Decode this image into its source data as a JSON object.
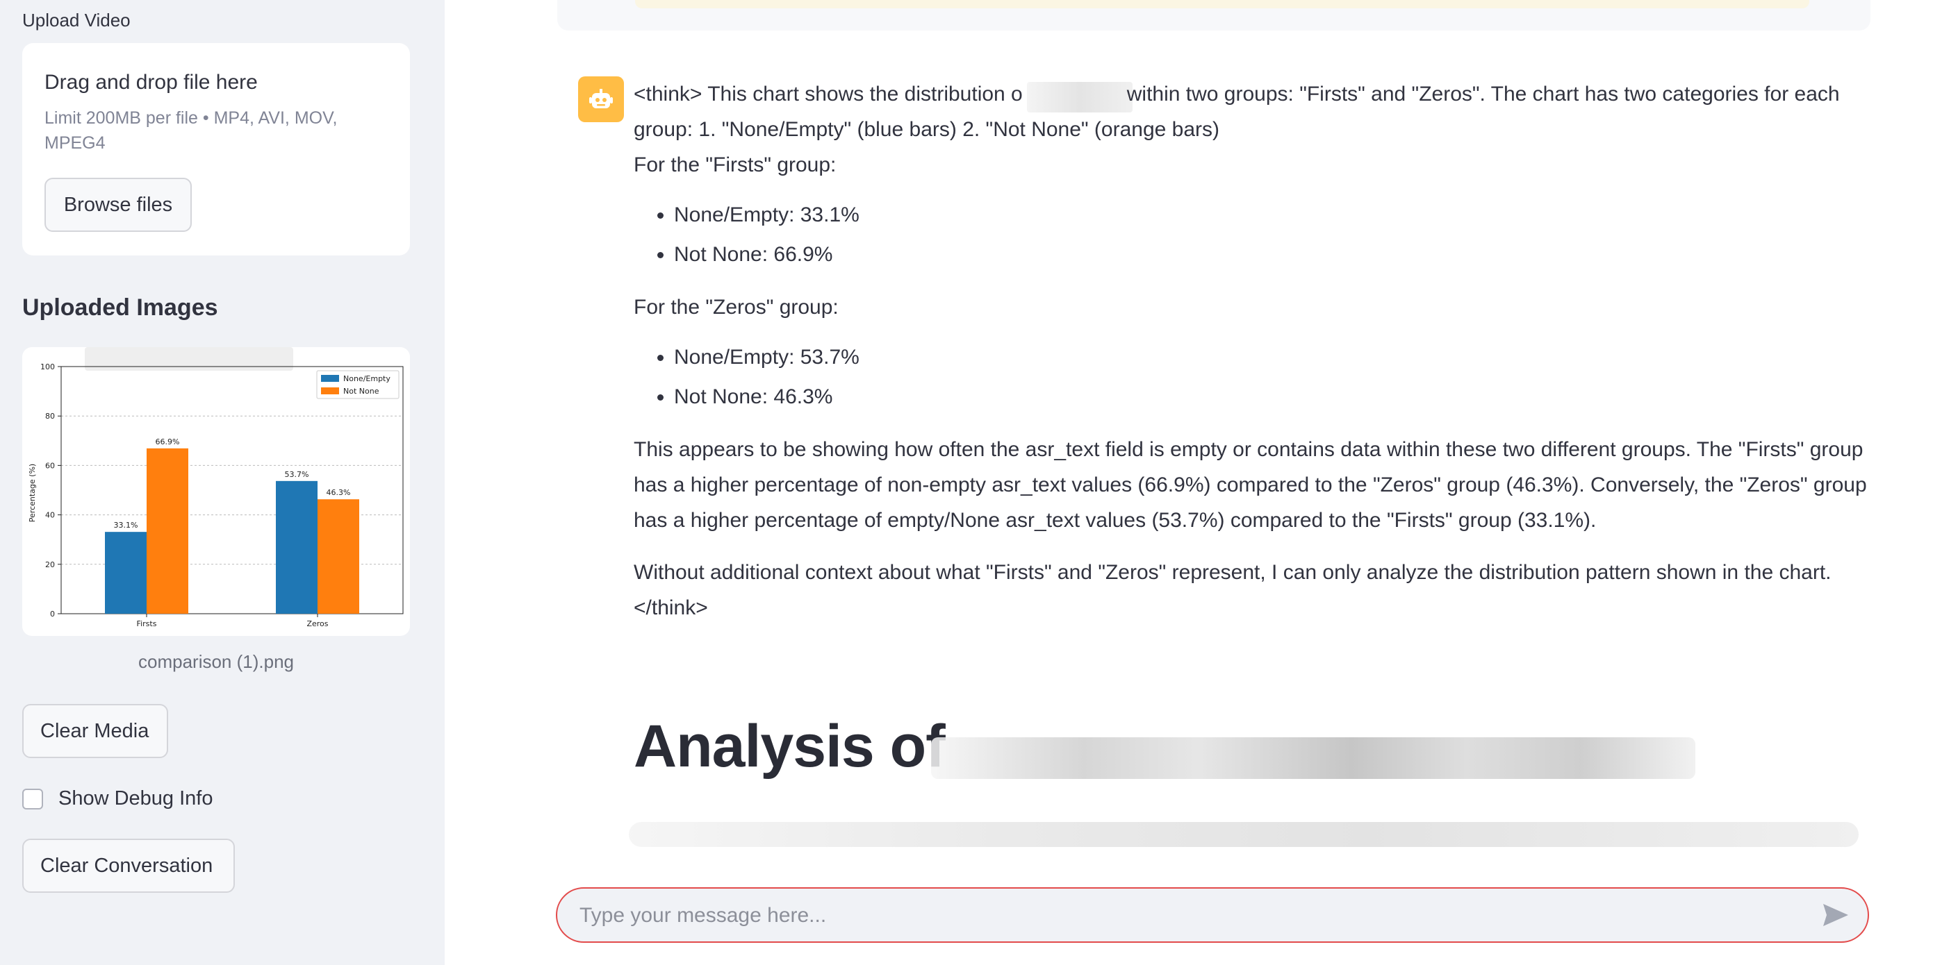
{
  "sidebar": {
    "upload_label": "Upload Video",
    "dropzone_title": "Drag and drop file here",
    "dropzone_limit": "Limit 200MB per file • MP4, AVI, MOV, MPEG4",
    "browse_label": "Browse files",
    "uploaded_heading": "Uploaded Images",
    "image_caption": "comparison (1).png",
    "clear_media_label": "Clear Media",
    "debug_label": "Show Debug Info",
    "debug_checked": false,
    "clear_conversation_label": "Clear Conversation"
  },
  "chart_data": {
    "type": "bar",
    "categories": [
      "Firsts",
      "Zeros"
    ],
    "series": [
      {
        "name": "None/Empty",
        "values": [
          33.1,
          53.7
        ],
        "color": "#1f77b4"
      },
      {
        "name": "Not None",
        "values": [
          66.9,
          46.3
        ],
        "color": "#ff7f0e"
      }
    ],
    "data_labels": [
      [
        "33.1%",
        "53.7%"
      ],
      [
        "66.9%",
        "46.3%"
      ]
    ],
    "ylabel": "Percentage (%)",
    "ylim": [
      0,
      100
    ],
    "yticks": [
      "0",
      "20",
      "40",
      "60",
      "80",
      "100"
    ],
    "grid": true,
    "legend_position": "top-right"
  },
  "chat": {
    "avatar_icon": "robot-icon",
    "intro_a": "<think> This chart shows the distribution o",
    "intro_b": "within two groups: \"Firsts\" and \"Zeros\". The chart has two categories for each group: 1. \"None/Empty\" (blue bars) 2. \"Not None\" (orange bars)",
    "firsts_heading": "For the \"Firsts\" group:",
    "firsts_items": [
      "None/Empty: 33.1%",
      "Not None: 66.9%"
    ],
    "zeros_heading": "For the \"Zeros\" group:",
    "zeros_items": [
      "None/Empty: 53.7%",
      "Not None: 46.3%"
    ],
    "paragraph_1": "This appears to be showing how often the asr_text field is empty or contains data within these two different groups. The \"Firsts\" group has a higher percentage of non-empty asr_text values (66.9%) compared to the \"Zeros\" group (46.3%). Conversely, the \"Zeros\" group has a higher percentage of empty/None asr_text values (53.7%) compared to the \"Firsts\" group (33.1%).",
    "paragraph_2": "Without additional context about what \"Firsts\" and \"Zeros\" represent, I can only analyze the distribution pattern shown in the chart. </think>",
    "analysis_heading": "Analysis of"
  },
  "input": {
    "placeholder": "Type your message here..."
  },
  "colors": {
    "accent_avatar": "#ffbd45",
    "input_border": "#e34b4b",
    "sidebar_bg": "#f0f2f6"
  }
}
